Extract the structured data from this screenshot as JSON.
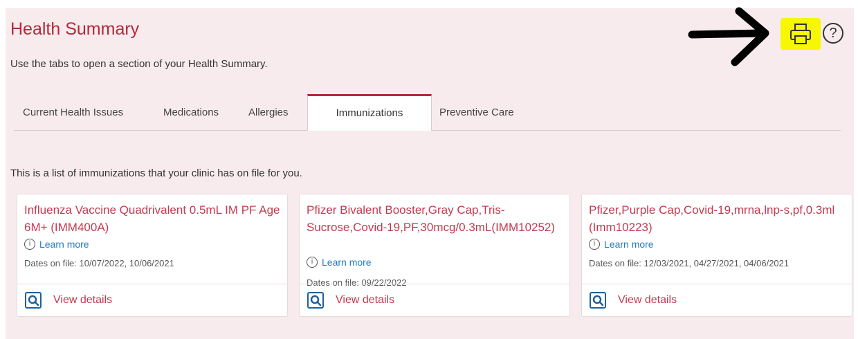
{
  "header": {
    "title": "Health Summary",
    "subtitle": "Use the tabs to open a section of your Health Summary."
  },
  "toolbar": {
    "help_label": "?"
  },
  "tabs": [
    {
      "label": "Current Health Issues"
    },
    {
      "label": "Medications"
    },
    {
      "label": "Allergies"
    },
    {
      "label": "Immunizations",
      "active": true
    },
    {
      "label": "Preventive Care"
    }
  ],
  "intro": "This is a list of immunizations that your clinic has on file for you.",
  "cards": [
    {
      "title": "Influenza Vaccine Quadrivalent 0.5mL IM PF Age 6M+ (IMM400A)",
      "learn_more": "Learn more",
      "dates": "Dates on file: 10/07/2022, 10/06/2021",
      "view_details": "View details"
    },
    {
      "title": "Pfizer Bivalent Booster,Gray Cap,Tris-Sucrose,Covid-19,PF,30mcg/0.3mL(IMM10252)",
      "learn_more": "Learn more",
      "dates": "Dates on file: 09/22/2022",
      "view_details": "View details"
    },
    {
      "title": "Pfizer,Purple Cap,Covid-19,mrna,lnp-s,pf,0.3ml (Imm10223)",
      "learn_more": "Learn more",
      "dates": "Dates on file: 12/03/2021, 04/27/2021, 04/06/2021",
      "view_details": "View details"
    }
  ],
  "colors": {
    "accent": "#b5273d",
    "link": "#1f7bc2",
    "panel_bg": "#f7ebed",
    "highlight": "#f7f700"
  },
  "icons": {
    "print": "printer-icon",
    "help": "help-icon",
    "info": "info-icon",
    "view": "view-details-icon",
    "annotation": "arrow-annotation"
  }
}
